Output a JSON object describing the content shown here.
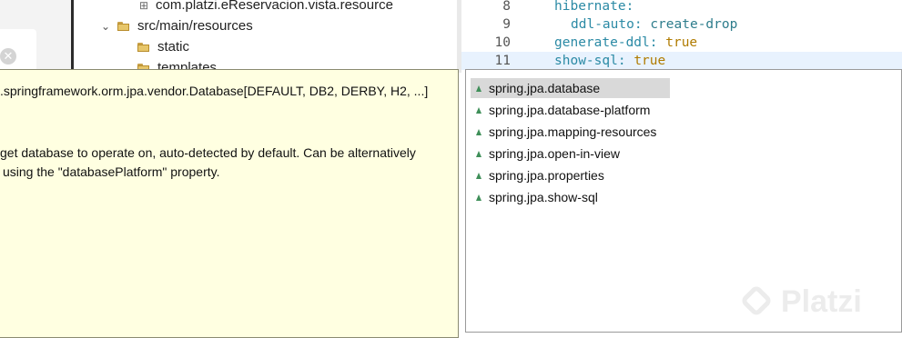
{
  "explorer": {
    "items": [
      {
        "label": "com.platzi.eReservacion.vista.resource",
        "type": "package"
      },
      {
        "label": "src/main/resources",
        "type": "folder",
        "expanded": true
      },
      {
        "label": "static",
        "type": "folder"
      },
      {
        "label": "templates",
        "type": "folder"
      }
    ]
  },
  "editor": {
    "lines": [
      {
        "number": "8",
        "key": "hibernate",
        "value": ""
      },
      {
        "number": "9",
        "key": "ddl-auto",
        "value": "create-drop"
      },
      {
        "number": "10",
        "key": "generate-ddl",
        "value": "true"
      },
      {
        "number": "11",
        "key": "show-sql",
        "value": "true"
      }
    ]
  },
  "doc_hover": {
    "type_line": ".springframework.orm.jpa.vendor.Database[DEFAULT, DB2, DERBY, H2, ...]",
    "desc_line1": "get database to operate on, auto-detected by default. Can be alternatively",
    "desc_line2": "using the \"databasePlatform\" property."
  },
  "content_assist": {
    "items": [
      "spring.jpa.database",
      "spring.jpa.database-platform",
      "spring.jpa.mapping-resources",
      "spring.jpa.open-in-view",
      "spring.jpa.properties",
      "spring.jpa.show-sql"
    ],
    "selected_index": 0
  },
  "watermark": {
    "text": "Platzi"
  },
  "colors": {
    "doc_background": "#ffffe1",
    "selection": "#d9d9d9",
    "current_line": "#e8f2fe",
    "yaml_key": "#2b8aa5",
    "yaml_bool": "#b07b00"
  }
}
